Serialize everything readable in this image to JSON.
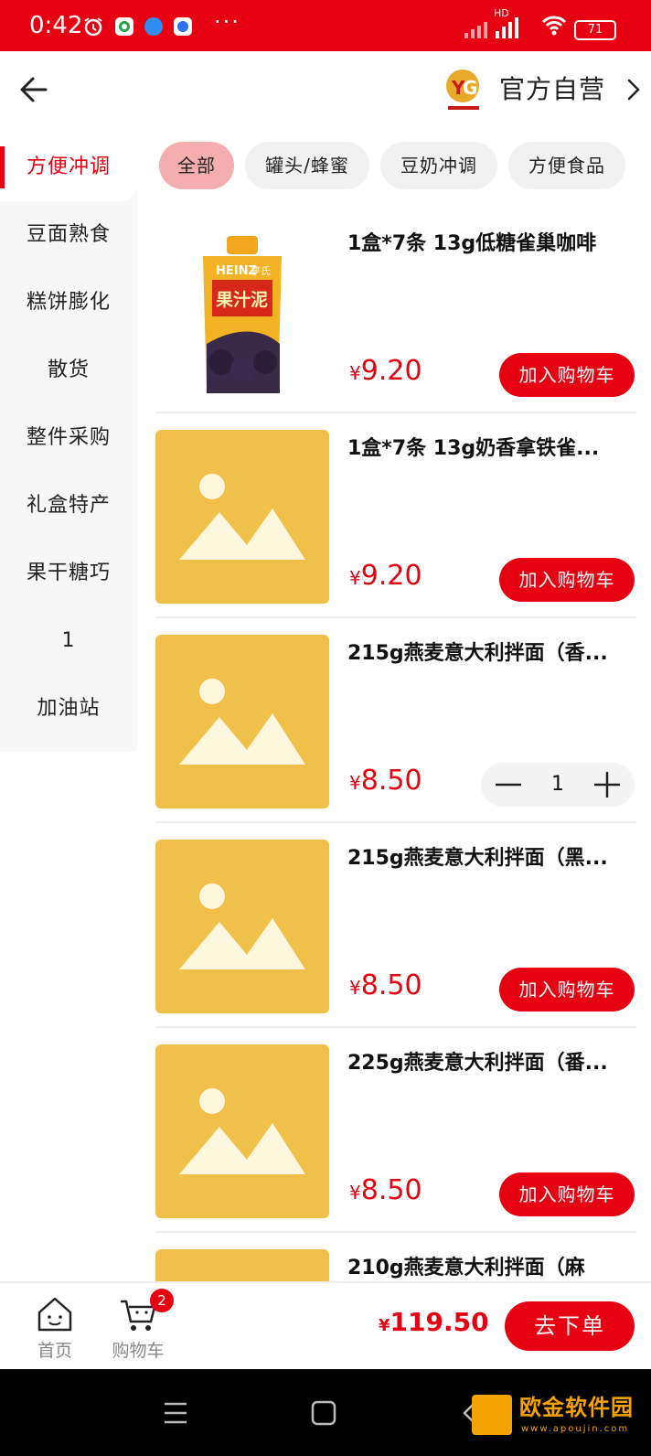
{
  "status_bar": {
    "time": "0:42",
    "battery": "71",
    "network": "HD",
    "more": "···"
  },
  "header": {
    "shop_name": "官方自营"
  },
  "sidebar": {
    "items": [
      {
        "label": "方便冲调",
        "active": true
      },
      {
        "label": "豆面熟食",
        "active": false
      },
      {
        "label": "糕饼膨化",
        "active": false
      },
      {
        "label": "散货",
        "active": false
      },
      {
        "label": "整件采购",
        "active": false
      },
      {
        "label": "礼盒特产",
        "active": false
      },
      {
        "label": "果干糖巧",
        "active": false
      },
      {
        "label": "1",
        "active": false
      },
      {
        "label": "加油站",
        "active": false
      }
    ]
  },
  "chips": [
    {
      "label": "全部",
      "active": true
    },
    {
      "label": "罐头/蜂蜜",
      "active": false
    },
    {
      "label": "豆奶冲调",
      "active": false
    },
    {
      "label": "方便食品",
      "active": false
    }
  ],
  "products": [
    {
      "name": "1盒*7条 13g低糖雀巢咖啡",
      "currency": "¥",
      "price": "9.20",
      "action": "加入购物车",
      "image": "photo"
    },
    {
      "name": "1盒*7条 13g奶香拿铁雀...",
      "currency": "¥",
      "price": "9.20",
      "action": "加入购物车",
      "image": "placeholder"
    },
    {
      "name": "215g燕麦意大利拌面（香...",
      "currency": "¥",
      "price": "8.50",
      "quantity": "1",
      "image": "placeholder"
    },
    {
      "name": "215g燕麦意大利拌面（黑...",
      "currency": "¥",
      "price": "8.50",
      "action": "加入购物车",
      "image": "placeholder"
    },
    {
      "name": "225g燕麦意大利拌面（番...",
      "currency": "¥",
      "price": "8.50",
      "action": "加入购物车",
      "image": "placeholder"
    },
    {
      "name": "210g燕麦意大利拌面（麻",
      "currency": "¥",
      "price": "",
      "action": "",
      "image": "placeholder"
    }
  ],
  "bottom_bar": {
    "home_label": "首页",
    "cart_label": "购物车",
    "cart_badge": "2",
    "currency": "¥",
    "total": "119.50",
    "order_label": "去下单"
  },
  "photo_labels": {
    "brand": "HEINZ",
    "brand_cn": "亨氏",
    "product": "果汁泥"
  },
  "watermark": {
    "text": "欧金软件园",
    "sub": "www.apoujin.com"
  },
  "colors": {
    "accent": "#e60012",
    "chip_active": "#f5aeb0",
    "placeholder": "#f1c04a"
  }
}
